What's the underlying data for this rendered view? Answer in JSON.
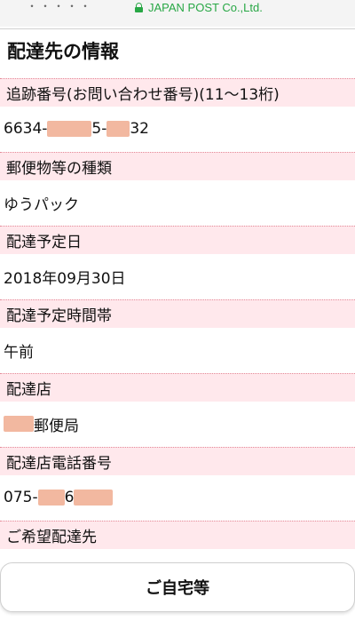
{
  "browser": {
    "domain": "JAPAN POST Co.,Ltd.",
    "cutoff_text": "・・・・・"
  },
  "section": {
    "title": "配達先の情報"
  },
  "fields": [
    {
      "label": "追跡番号(お問い合わせ番号)(11〜13桁)",
      "value_prefix": "6634-",
      "value_mid": "5-",
      "value_suffix": "32"
    },
    {
      "label": "郵便物等の種類",
      "value": "ゆうパック"
    },
    {
      "label": "配達予定日",
      "value": "2018年09月30日"
    },
    {
      "label": "配達予定時間帯",
      "value": "午前"
    },
    {
      "label": "配達店",
      "value_suffix": "郵便局"
    },
    {
      "label": "配達店電話番号",
      "value_prefix": "075-",
      "value_mid": "6"
    },
    {
      "label": "ご希望配達先"
    }
  ],
  "button": {
    "label": "ご自宅等"
  },
  "colors": {
    "label_bg": "#ffe8ec",
    "redaction": "#f2b8a0",
    "secure_green": "#28a745"
  }
}
